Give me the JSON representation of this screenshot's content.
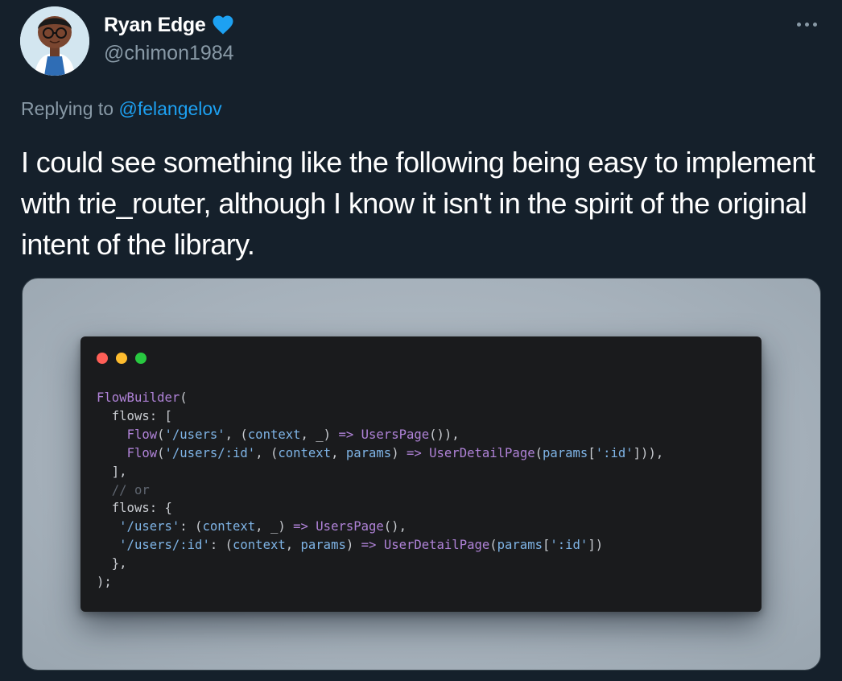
{
  "author": {
    "display_name": "Ryan Edge",
    "handle": "@chimon1984"
  },
  "reply": {
    "prefix": "Replying to ",
    "mention": "@felangelov"
  },
  "tweet": {
    "text": "I could see something like the following being easy to implement with trie_router, although I know it isn't in the spirit of the original intent of the library."
  },
  "code_snippet": {
    "lines": [
      [
        [
          "k",
          "FlowBuilder"
        ],
        [
          "t",
          "("
        ]
      ],
      [
        [
          "t",
          "  flows: ["
        ]
      ],
      [
        [
          "t",
          "    "
        ],
        [
          "k",
          "Flow"
        ],
        [
          "t",
          "("
        ],
        [
          "s",
          "'/users'"
        ],
        [
          "t",
          ", ("
        ],
        [
          "s",
          "context"
        ],
        [
          "t",
          ", _) "
        ],
        [
          "k",
          "=>"
        ],
        [
          "t",
          " "
        ],
        [
          "k",
          "UsersPage"
        ],
        [
          "t",
          "()),"
        ]
      ],
      [
        [
          "t",
          "    "
        ],
        [
          "k",
          "Flow"
        ],
        [
          "t",
          "("
        ],
        [
          "s",
          "'/users/:id'"
        ],
        [
          "t",
          ", ("
        ],
        [
          "s",
          "context"
        ],
        [
          "t",
          ", "
        ],
        [
          "s",
          "params"
        ],
        [
          "t",
          ") "
        ],
        [
          "k",
          "=>"
        ],
        [
          "t",
          " "
        ],
        [
          "k",
          "UserDetailPage"
        ],
        [
          "t",
          "("
        ],
        [
          "s",
          "params"
        ],
        [
          "t",
          "["
        ],
        [
          "s",
          "':id'"
        ],
        [
          "t",
          "])),"
        ]
      ],
      [
        [
          "t",
          "  ],"
        ]
      ],
      [
        [
          "c",
          "  // or"
        ]
      ],
      [
        [
          "t",
          "  flows: {"
        ]
      ],
      [
        [
          "t",
          "   "
        ],
        [
          "s",
          "'/users'"
        ],
        [
          "t",
          ": ("
        ],
        [
          "s",
          "context"
        ],
        [
          "t",
          ", _) "
        ],
        [
          "k",
          "=>"
        ],
        [
          "t",
          " "
        ],
        [
          "k",
          "UsersPage"
        ],
        [
          "t",
          "(),"
        ]
      ],
      [
        [
          "t",
          "   "
        ],
        [
          "s",
          "'/users/:id'"
        ],
        [
          "t",
          ": ("
        ],
        [
          "s",
          "context"
        ],
        [
          "t",
          ", "
        ],
        [
          "s",
          "params"
        ],
        [
          "t",
          ") "
        ],
        [
          "k",
          "=>"
        ],
        [
          "t",
          " "
        ],
        [
          "k",
          "UserDetailPage"
        ],
        [
          "t",
          "("
        ],
        [
          "s",
          "params"
        ],
        [
          "t",
          "["
        ],
        [
          "s",
          "':id'"
        ],
        [
          "t",
          "])"
        ]
      ],
      [
        [
          "t",
          "  },"
        ]
      ],
      [
        [
          "t",
          ");"
        ]
      ]
    ]
  },
  "colors": {
    "background": "#15202b",
    "verified": "#1da1f2",
    "link": "#1da1f2",
    "secondary_text": "#8899a6"
  },
  "icons": [
    "avatar",
    "verified-badge-icon",
    "more-options-icon"
  ]
}
